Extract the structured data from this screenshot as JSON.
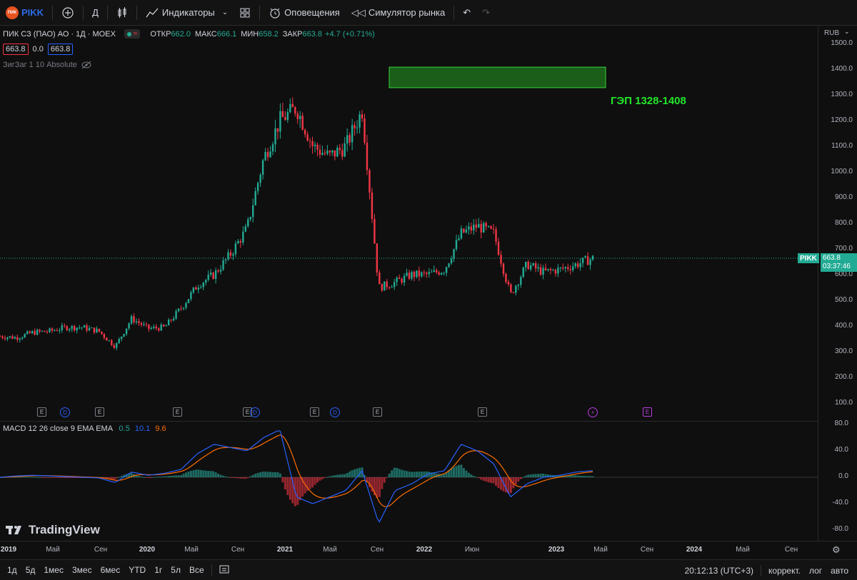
{
  "toolbar": {
    "logo_text": "ПИК",
    "symbol": "PIKK",
    "interval": "Д",
    "indicators_label": "Индикаторы",
    "alerts_label": "Оповещения",
    "replay_label": "Симулятор рынка"
  },
  "legend": {
    "title": "ПИК СЗ (ПАО) АО · 1Д · MOEX",
    "open_label": "ОТКР",
    "open_value": "662.0",
    "high_label": "МАКС",
    "high_value": "666.1",
    "low_label": "МИН",
    "low_value": "658.2",
    "close_label": "ЗАКР",
    "close_value": "663.8",
    "change": "+4.7 (+0.71%)",
    "sell_price": "663.8",
    "spread": "0.0",
    "buy_price": "663.8",
    "indicator": "ЗигЗаг 1 10 Absolute"
  },
  "annotation": {
    "gap_label": "ГЭП 1328-1408",
    "gap_low": 1328,
    "gap_high": 1408
  },
  "price_axis": {
    "currency": "RUB",
    "ticks": [
      "1500.0",
      "1400.0",
      "1300.0",
      "1200.0",
      "1100.0",
      "1000.0",
      "900.0",
      "800.0",
      "700.0",
      "600.0",
      "500.0",
      "400.0",
      "300.0",
      "200.0",
      "100.0"
    ],
    "last_symbol": "PIKK",
    "last_price": "663.8",
    "countdown": "03:37:46"
  },
  "macd": {
    "label": "MACD 12 26 close 9 EMA EMA",
    "hist": "0.5",
    "macd": "10.1",
    "signal": "9.6",
    "ticks": [
      "80.0",
      "40.0",
      "0.0",
      "-40.0",
      "-80.0"
    ]
  },
  "time_axis": [
    "2019",
    "Май",
    "Сен",
    "2020",
    "Май",
    "Сен",
    "2021",
    "Май",
    "Сен",
    "2022",
    "Июн",
    "2023",
    "Май",
    "Сен",
    "2024",
    "Май",
    "Сен"
  ],
  "events": [
    "E",
    "D",
    "E",
    "E",
    "E",
    "D",
    "E",
    "D",
    "E",
    "E",
    "⚡",
    "E"
  ],
  "watermark": "TradingView",
  "bottom": {
    "ranges": [
      "1д",
      "5д",
      "1мес",
      "3мес",
      "6мес",
      "YTD",
      "1г",
      "5л",
      "Все"
    ],
    "clock": "20:12:13 (UTC+3)",
    "adjust": "коррект.",
    "log": "лог",
    "auto": "авто"
  },
  "colors": {
    "up": "#22ab94",
    "down": "#f23645",
    "macd_line": "#2962ff",
    "signal_line": "#ff6d00",
    "gap_fill": "#1f7a1f",
    "gap_text": "#22e52a"
  },
  "chart_data": {
    "type": "line",
    "title": "ПИК СЗ (ПАО) АО · 1Д · MOEX",
    "ylim": [
      50,
      1560
    ],
    "x": [
      "2019-01",
      "2019-03",
      "2019-05",
      "2019-07",
      "2019-09",
      "2019-11",
      "2020-01",
      "2020-03",
      "2020-05",
      "2020-07",
      "2020-09",
      "2020-11",
      "2021-01",
      "2021-03",
      "2021-05",
      "2021-07",
      "2021-08",
      "2021-09",
      "2021-10",
      "2021-11",
      "2021-12",
      "2022-01",
      "2022-02",
      "2022-03",
      "2022-04",
      "2022-05",
      "2022-06",
      "2022-07",
      "2022-08",
      "2022-09",
      "2022-10",
      "2022-11",
      "2022-12",
      "2023-01",
      "2023-02",
      "2023-03",
      "2023-04"
    ],
    "series": [
      {
        "values": [
          360,
          355,
          375,
          380,
          395,
          395,
          380,
          320,
          430,
          390,
          395,
          470,
          560,
          600,
          680,
          780,
          1050,
          1200,
          1250,
          1100,
          1060,
          1100,
          1240,
          550,
          570,
          600,
          600,
          620,
          760,
          790,
          760,
          520,
          640,
          610,
          620,
          640,
          664
        ]
      }
    ],
    "macd_series": [
      {
        "values": [
          0,
          2,
          3,
          2,
          1,
          0,
          -1,
          -8,
          8,
          3,
          6,
          12,
          36,
          50,
          45,
          40,
          60,
          72,
          -30,
          -40,
          -30,
          -20,
          10,
          -70,
          -20,
          -10,
          5,
          10,
          50,
          40,
          20,
          -30,
          -10,
          0,
          3,
          8,
          10
        ]
      }
    ]
  }
}
